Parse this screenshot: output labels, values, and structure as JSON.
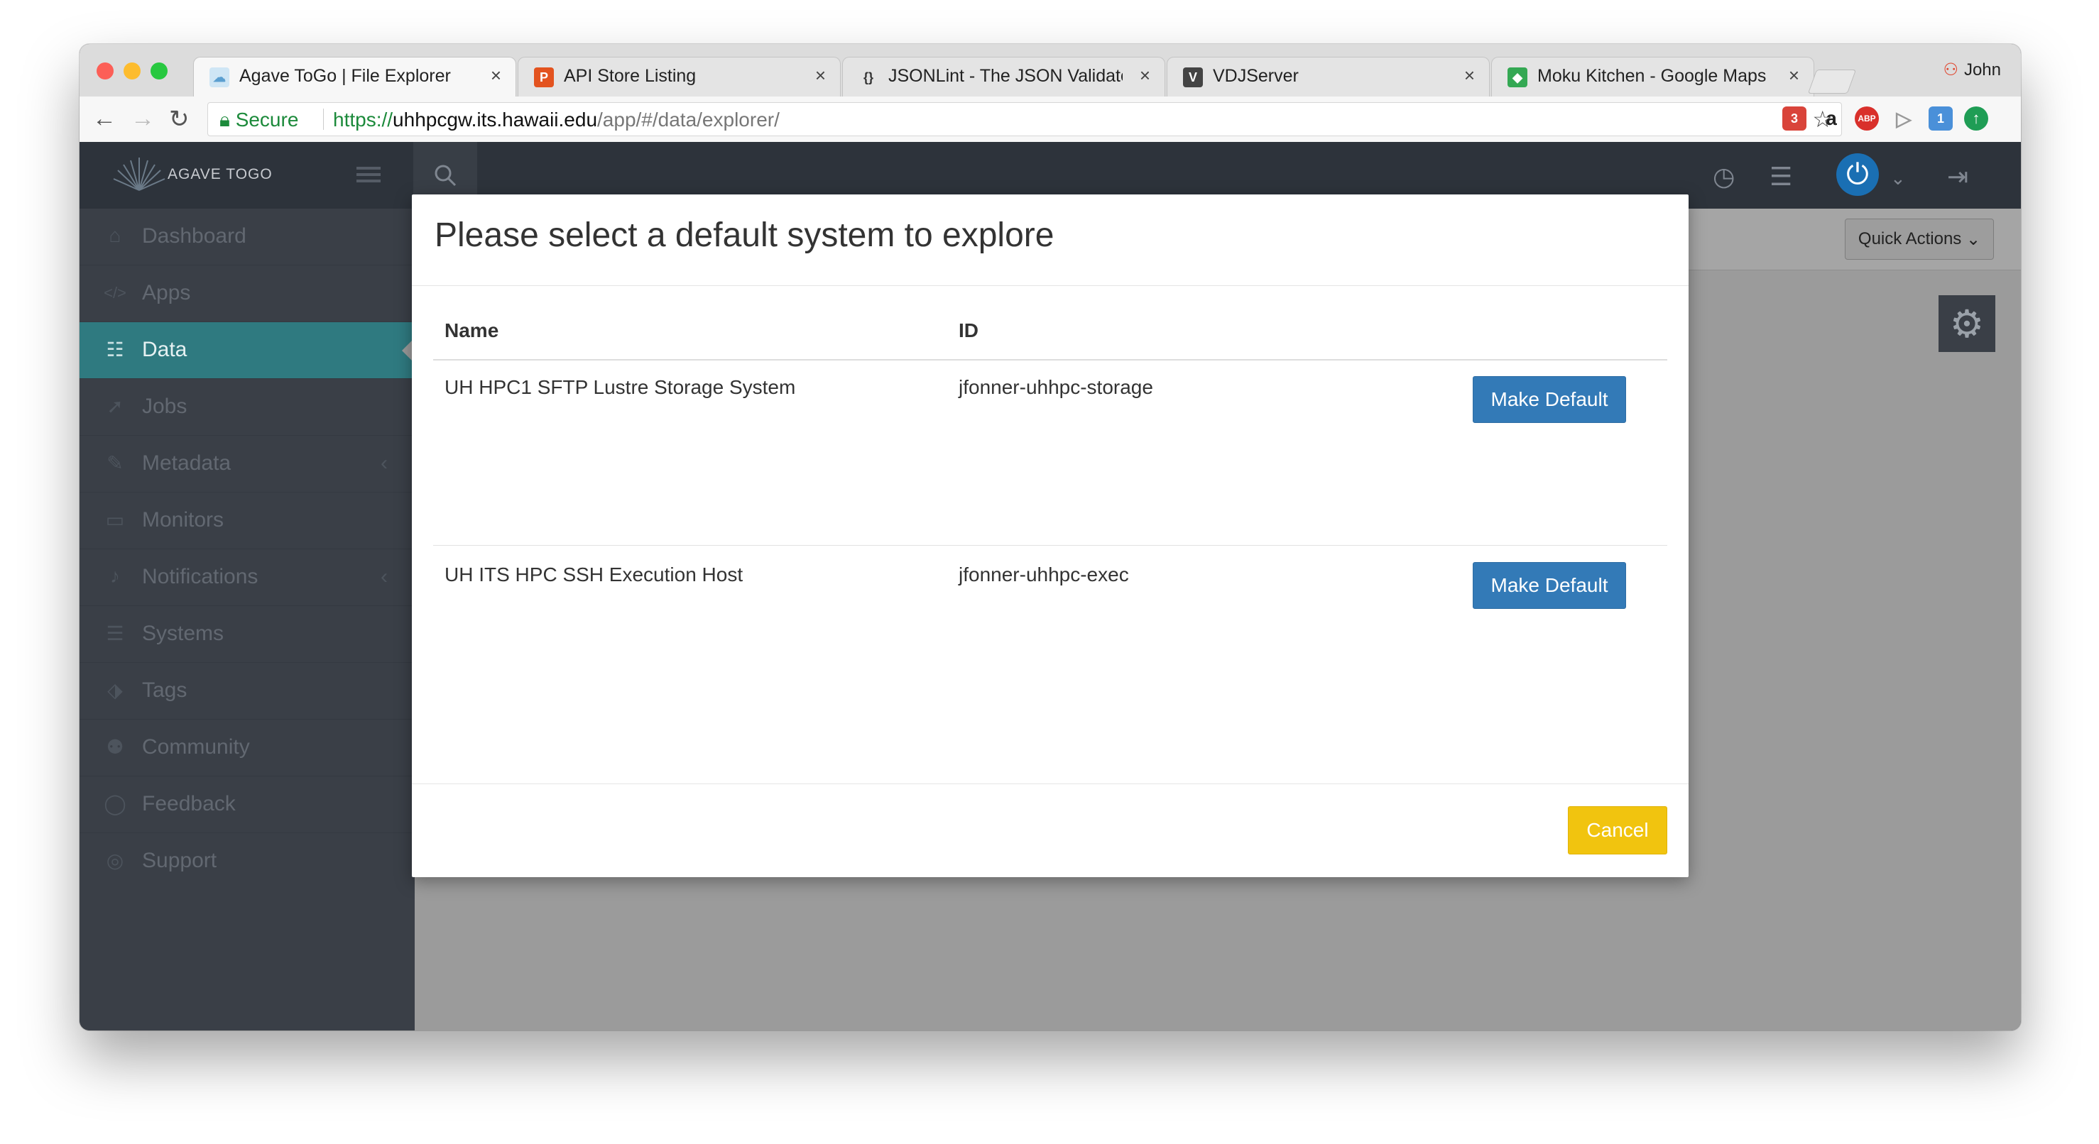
{
  "browser": {
    "tabs": [
      {
        "title": "Agave ToGo | File Explorer",
        "active": true
      },
      {
        "title": "API Store Listing"
      },
      {
        "title": "JSONLint - The JSON Validator"
      },
      {
        "title": "VDJServer"
      },
      {
        "title": "Moku Kitchen - Google Maps"
      }
    ],
    "user": "John",
    "secure_label": "Secure",
    "url": {
      "scheme": "https://",
      "host": "uhhpcgw.its.hawaii.edu",
      "path": "/app/#/data/explorer/"
    },
    "extension_badges": {
      "calendar": "3",
      "translate": "1",
      "abp": "ABP"
    }
  },
  "app": {
    "brand": "AGAVE TOGO",
    "sidebar": [
      {
        "label": "Dashboard",
        "icon": "home-icon"
      },
      {
        "label": "Apps",
        "icon": "code-icon"
      },
      {
        "label": "Data",
        "icon": "database-icon",
        "active": true
      },
      {
        "label": "Jobs",
        "icon": "rocket-icon"
      },
      {
        "label": "Metadata",
        "icon": "edit-icon",
        "chevron": true
      },
      {
        "label": "Monitors",
        "icon": "monitor-icon"
      },
      {
        "label": "Notifications",
        "icon": "bell-icon",
        "chevron": true
      },
      {
        "label": "Systems",
        "icon": "server-icon"
      },
      {
        "label": "Tags",
        "icon": "tags-icon"
      },
      {
        "label": "Community",
        "icon": "users-icon"
      },
      {
        "label": "Feedback",
        "icon": "comment-icon"
      },
      {
        "label": "Support",
        "icon": "lifebuoy-icon"
      }
    ],
    "quick_actions": "Quick Actions"
  },
  "modal": {
    "title": "Please select a default system to explore",
    "columns": {
      "name": "Name",
      "id": "ID"
    },
    "rows": [
      {
        "name": "UH HPC1 SFTP Lustre Storage System",
        "id": "jfonner-uhhpc-storage",
        "action": "Make Default"
      },
      {
        "name": "UH ITS HPC SSH Execution Host",
        "id": "jfonner-uhhpc-exec",
        "action": "Make Default"
      }
    ],
    "cancel": "Cancel"
  },
  "colors": {
    "primary": "#337ab7",
    "warning": "#f1c40f",
    "sidebar_active": "#2f7a80",
    "sidebar_bg": "#3a3f47"
  }
}
